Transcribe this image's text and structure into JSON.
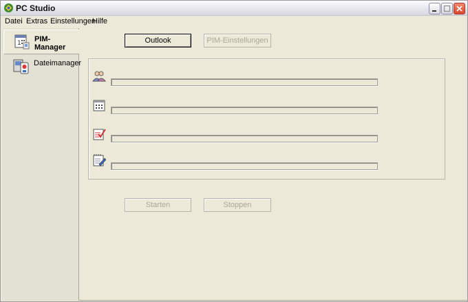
{
  "window": {
    "title": "PC Studio"
  },
  "menu": [
    "Datei",
    "Extras",
    "Einstellungen",
    "Hilfe"
  ],
  "nav": {
    "items": [
      {
        "label": "PIM-Manager",
        "icon": "pim-manager-icon",
        "active": true
      },
      {
        "label": "Dateimanager",
        "icon": "file-manager-icon",
        "active": false
      }
    ]
  },
  "toolbar": {
    "outlook_label": "Outlook",
    "pim_settings_label": "PIM-Einstellungen"
  },
  "sync_rows": [
    {
      "icon": "contacts-icon",
      "progress": 0
    },
    {
      "icon": "calendar-icon",
      "progress": 0
    },
    {
      "icon": "tasks-icon",
      "progress": 0
    },
    {
      "icon": "notes-icon",
      "progress": 0
    }
  ],
  "actions": {
    "start_label": "Starten",
    "stop_label": "Stoppen"
  },
  "colors": {
    "accent": "#316AC5",
    "background": "#ECE9D8"
  }
}
